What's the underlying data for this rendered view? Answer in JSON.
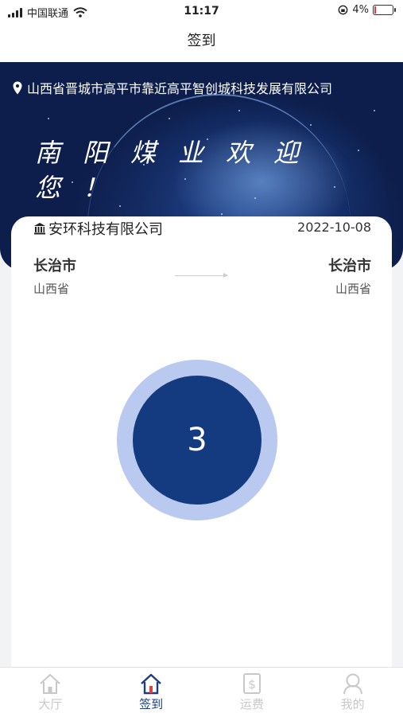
{
  "status_bar": {
    "carrier": "中国联通",
    "time": "11:17",
    "battery": "4%"
  },
  "nav": {
    "title": "签到"
  },
  "banner": {
    "location": "山西省晋城市高平市靠近高平智创城科技发展有限公司",
    "welcome": "南阳煤业欢迎您！"
  },
  "card": {
    "company": "安环科技有限公司",
    "date": "2022-10-08",
    "origin": {
      "city": "长治市",
      "province": "山西省"
    },
    "destination": {
      "city": "长治市",
      "province": "山西省"
    },
    "countdown": "3"
  },
  "tabs": [
    {
      "label": "大厅",
      "icon": "home-icon"
    },
    {
      "label": "签到",
      "icon": "checkin-home-icon"
    },
    {
      "label": "运费",
      "icon": "fee-icon"
    },
    {
      "label": "我的",
      "icon": "profile-icon"
    }
  ],
  "colors": {
    "primary": "#143a80",
    "ring": "#b9c9ef",
    "active_tab": "#1d3d82",
    "inactive_tab": "#c8c8c8"
  }
}
